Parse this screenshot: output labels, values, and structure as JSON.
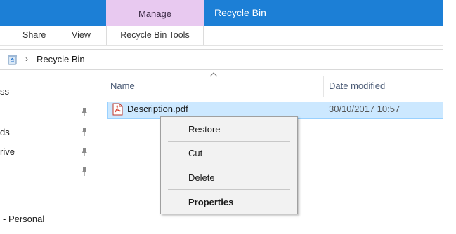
{
  "title_bar": {
    "context_tab": "Manage",
    "window_title": "Recycle Bin"
  },
  "ribbon": {
    "tabs": [
      "Share",
      "View"
    ],
    "context_group": "Recycle Bin Tools"
  },
  "address_bar": {
    "icon": "recycle-bin-icon",
    "path": "Recycle Bin"
  },
  "nav_pane": {
    "items": [
      "ss",
      "ds",
      "rive",
      "- Personal"
    ]
  },
  "file_list": {
    "columns": [
      "Name",
      "Date modified"
    ],
    "rows": [
      {
        "name": "Description.pdf",
        "date_modified": "30/10/2017 10:57",
        "icon": "pdf-file-icon"
      }
    ]
  },
  "context_menu": {
    "items": [
      "Restore",
      "Cut",
      "Delete",
      "Properties"
    ]
  },
  "colors": {
    "title_bar": "#1c7fd6",
    "manage_tab": "#e8c9f0",
    "selection": "#cce8ff"
  }
}
